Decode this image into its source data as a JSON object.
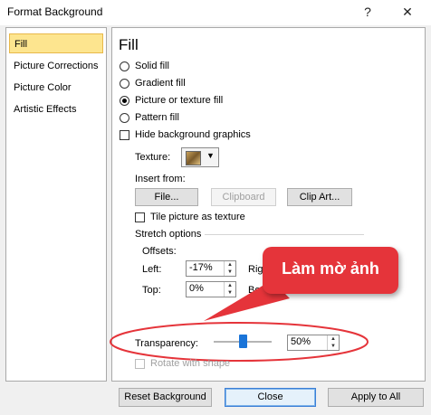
{
  "window": {
    "title": "Format Background",
    "help_glyph": "?",
    "close_glyph": "✕"
  },
  "sidebar": {
    "items": [
      {
        "label": "Fill",
        "selected": true
      },
      {
        "label": "Picture Corrections"
      },
      {
        "label": "Picture Color"
      },
      {
        "label": "Artistic Effects"
      }
    ]
  },
  "fill": {
    "heading": "Fill",
    "options": [
      {
        "label": "Solid fill",
        "checked": false
      },
      {
        "label": "Gradient fill",
        "checked": false
      },
      {
        "label": "Picture or texture fill",
        "checked": true
      },
      {
        "label": "Pattern fill",
        "checked": false
      }
    ],
    "hide_graphics_label": "Hide background graphics",
    "texture_label": "Texture:",
    "insert_from_label": "Insert from:",
    "file_button": "File...",
    "clipboard_button": "Clipboard",
    "clipart_button": "Clip Art...",
    "tile_label": "Tile picture as texture",
    "stretch_label": "Stretch options",
    "offsets_label": "Offsets:",
    "left_label": "Left:",
    "left_value": "-17%",
    "right_label_partial": "Rig",
    "top_label": "Top:",
    "top_value": "0%",
    "bottom_label_partial": "Bo",
    "transparency_label": "Transparency:",
    "transparency_value": "50%",
    "transparency_fraction": 0.5,
    "rotate_label": "Rotate with shape"
  },
  "callout": {
    "text": "Làm mờ ảnh",
    "color": "#e5343a"
  },
  "footer": {
    "reset_button": "Reset Background",
    "close_button": "Close",
    "apply_all_button": "Apply to All"
  },
  "colors": {
    "accent": "#1a74d8",
    "selected_item": "#fde58f",
    "highlight_ellipse": "#e5343a"
  }
}
